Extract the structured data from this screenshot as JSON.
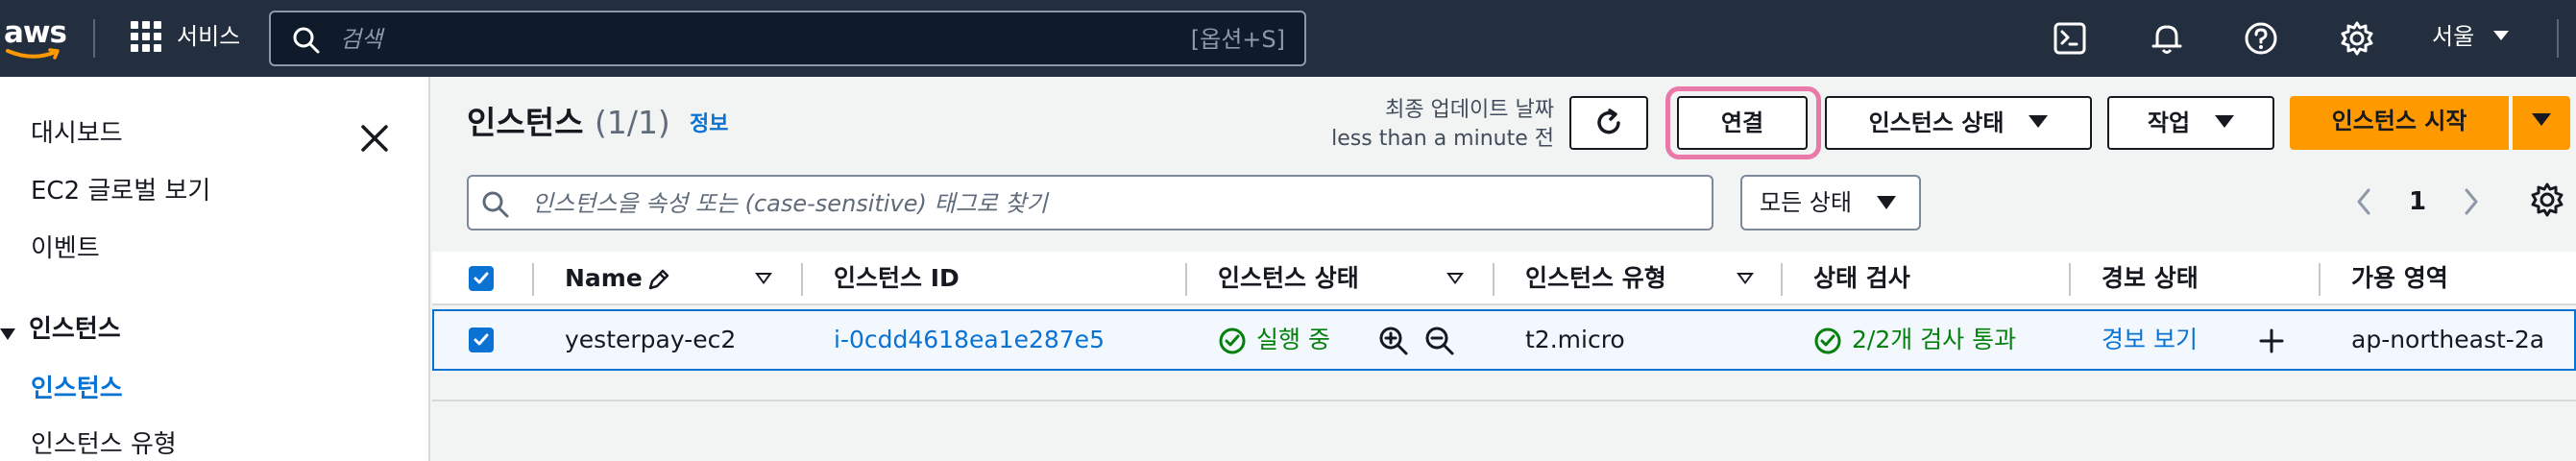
{
  "topbar": {
    "logo_text": "aws",
    "services_label": "서비스",
    "search_placeholder": "검색",
    "search_shortcut": "[옵션+S]",
    "region": "서울"
  },
  "sidebar": {
    "items": [
      {
        "label": "대시보드"
      },
      {
        "label": "EC2 글로벌 보기"
      },
      {
        "label": "이벤트"
      }
    ],
    "section_label": "인스턴스",
    "sub_items": [
      {
        "label": "인스턴스",
        "active": true
      },
      {
        "label": "인스턴스 유형",
        "active": false
      }
    ]
  },
  "main": {
    "title": "인스턴스",
    "count": "(1/1)",
    "info_link": "정보",
    "last_update_label": "최종 업데이트 날짜",
    "last_update_value": "less than a minute 전",
    "buttons": {
      "connect": "연결",
      "instance_state": "인스턴스 상태",
      "actions": "작업",
      "launch": "인스턴스 시작"
    },
    "filter_placeholder": "인스턴스을 속성 또는 (case-sensitive) 태그로 찾기",
    "state_filter": "모든 상태",
    "page_number": "1"
  },
  "table": {
    "columns": [
      "Name",
      "인스턴스 ID",
      "인스턴스 상태",
      "인스턴스 유형",
      "상태 검사",
      "경보 상태",
      "가용 영역"
    ],
    "rows": [
      {
        "name": "yesterpay-ec2",
        "instance_id": "i-0cdd4618ea1e287e5",
        "state": "실행 중",
        "type": "t2.micro",
        "status_check": "2/2개 검사 통과",
        "alarm": "경보 보기",
        "az": "ap-northeast-2a"
      }
    ]
  },
  "colors": {
    "topbar_bg": "#232f3e",
    "accent_blue": "#0972d3",
    "primary_orange": "#ff9900",
    "success_green": "#037f0c",
    "highlight_pink": "#e879a8"
  }
}
